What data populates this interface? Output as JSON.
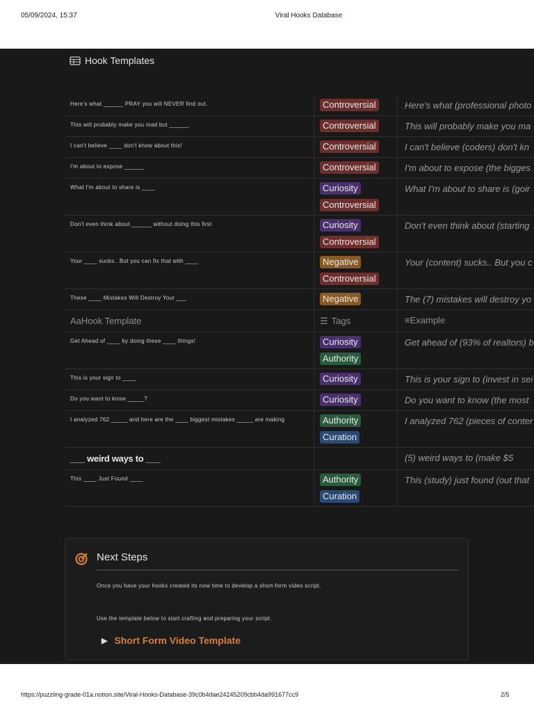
{
  "print_header": {
    "datetime": "05/09/2024, 15:37",
    "title": "Viral Hooks Database"
  },
  "print_footer": {
    "url": "https://puzzling-grade-01a.notion.site/Viral-Hooks-Database-39c0b4dae24245209cbb4da991677cc9",
    "page": "2/5"
  },
  "database": {
    "title": "Hook Templates",
    "columns": {
      "hook": "Hook Template",
      "tags": "Tags",
      "example": "Example"
    },
    "rows_top": [
      {
        "hook": "Here's what ______ PRAY you will NEVER find out.",
        "tags": [
          "Controversial"
        ],
        "example": "Here's what (professional photo"
      },
      {
        "hook": "This will probably make you mad but ______",
        "tags": [
          "Controversial"
        ],
        "example": "This will probably make you ma"
      },
      {
        "hook": "I can't believe ____ don't know about this!",
        "tags": [
          "Controversial"
        ],
        "example": "I can't believe (coders) don't kn"
      },
      {
        "hook": "I'm about to expose ______",
        "tags": [
          "Controversial"
        ],
        "example": "I'm about to expose (the bigges"
      },
      {
        "hook": "What I'm about to share is ____",
        "tags": [
          "Curiosity",
          "Controversial"
        ],
        "example": "What I'm about to share is (goir"
      },
      {
        "hook": "Don't even think about ______ without doing this first",
        "tags": [
          "Curiosity",
          "Controversial"
        ],
        "example": "Don't even think about (starting"
      },
      {
        "hook": "Your ____ sucks.. But you can fix that with ____",
        "tags": [
          "Negative",
          "Controversial"
        ],
        "example": "Your (content) sucks.. But you c"
      },
      {
        "hook": "These ____ Mistakes Will Destroy Your ___",
        "tags": [
          "Negative"
        ],
        "example": "The (7) mistakes will destroy yo"
      }
    ],
    "rows_bottom": [
      {
        "hook": "Get Ahead of ____ by doing these ____ things!",
        "tags": [
          "Curiosity",
          "Authority"
        ],
        "example": "Get ahead of (93% of realtors) b"
      },
      {
        "hook": "This is your sign to ____",
        "tags": [
          "Curiosity"
        ],
        "example": "This is your sign to (invest in sei"
      },
      {
        "hook": "Do you want to know _____?",
        "tags": [
          "Curiosity"
        ],
        "example": "Do you want to know (the most"
      },
      {
        "hook": "I analyzed 762 _____ and here are the ____ biggest mistakes _____ are making",
        "tags": [
          "Authority",
          "Curation"
        ],
        "example": "I analyzed 762 (pieces of conter"
      },
      {
        "hook": "___ weird ways to ___",
        "tags": [],
        "example": "(5) weird ways to (make $5",
        "big": true
      },
      {
        "hook": "This ____ Just Found ____",
        "tags": [
          "Authority",
          "Curation"
        ],
        "example": "This (study) just found (out that"
      }
    ]
  },
  "tag_colors": {
    "Controversial": "#6e2f2c",
    "Curiosity": "#4a2f6e",
    "Negative": "#8a5a22",
    "Authority": "#2b5a3c",
    "Curation": "#284a74"
  },
  "next_steps": {
    "title": "Next Steps",
    "p1": "Once you have your hooks created its now time to develop a short-form video script.",
    "p2": "Use the template below to start crafting and preparing your script.",
    "toggle": "Short Form Video Template",
    "accent": "#d97f36"
  }
}
